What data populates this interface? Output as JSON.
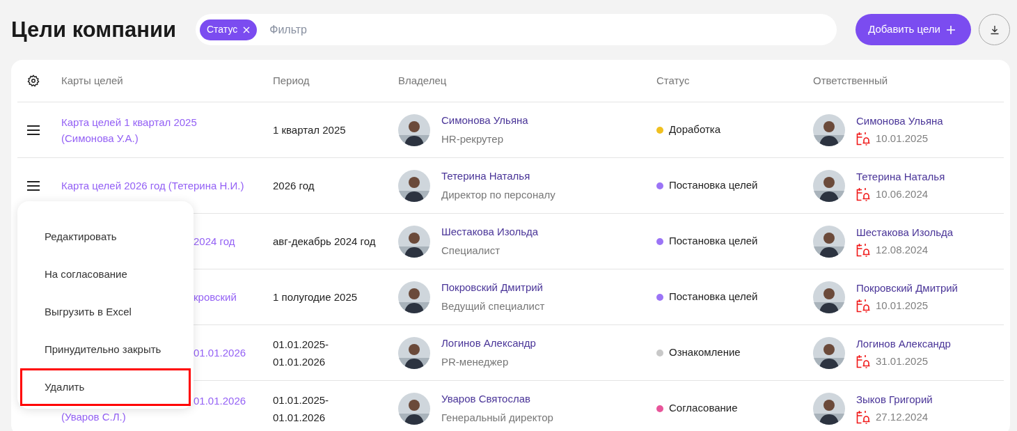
{
  "page": {
    "title": "Цели компании"
  },
  "filter": {
    "chips": [
      {
        "label": "Статус"
      }
    ],
    "placeholder": "Фильтр"
  },
  "actions": {
    "add_button": "Добавить цели"
  },
  "table": {
    "columns": [
      "Карты целей",
      "Период",
      "Владелец",
      "Статус",
      "Ответственный"
    ],
    "rows": [
      {
        "menu_icon": true,
        "goal_lines": [
          {
            "text": "Карта целей 1 квартал 2025",
            "covered": false
          },
          {
            "text": "(Симонова У.А.)",
            "covered": false
          }
        ],
        "period_lines": [
          "1 квартал 2025"
        ],
        "owner": {
          "name": "Симонова Ульяна",
          "role": "HR-рекрутер"
        },
        "status": {
          "label": "Доработка",
          "color": "#f0c020"
        },
        "responsible": {
          "name": "Симонова Ульяна",
          "date": "10.01.2025"
        }
      },
      {
        "menu_icon": true,
        "goal_lines": [
          {
            "text": "Карта целей 2026 год (Тетерина Н.И.)",
            "covered": false
          }
        ],
        "period_lines": [
          "2026 год"
        ],
        "owner": {
          "name": "Тетерина Наталья",
          "role": "Директор по персоналу"
        },
        "status": {
          "label": "Постановка целей",
          "color": "#9b74f6"
        },
        "responsible": {
          "name": "Тетерина Наталья",
          "date": "10.06.2024"
        }
      },
      {
        "menu_icon": false,
        "goal_lines": [
          {
            "text": "2024 год",
            "covered": true
          }
        ],
        "period_lines": [
          "авг-декабрь 2024 год"
        ],
        "owner": {
          "name": "Шестакова Изольда",
          "role": "Специалист"
        },
        "status": {
          "label": "Постановка целей",
          "color": "#9b74f6"
        },
        "responsible": {
          "name": "Шестакова Изольда",
          "date": "12.08.2024"
        }
      },
      {
        "menu_icon": false,
        "goal_lines": [
          {
            "text": "кровский",
            "covered": true
          }
        ],
        "period_lines": [
          "1 полугодие 2025"
        ],
        "owner": {
          "name": "Покровский Дмитрий",
          "role": "Ведущий специалист"
        },
        "status": {
          "label": "Постановка целей",
          "color": "#9b74f6"
        },
        "responsible": {
          "name": "Покровский Дмитрий",
          "date": "10.01.2025"
        }
      },
      {
        "menu_icon": false,
        "goal_lines": [
          {
            "text": "01.01.2026",
            "covered": true
          }
        ],
        "period_lines": [
          "01.01.2025-",
          "01.01.2026"
        ],
        "owner": {
          "name": "Логинов Александр",
          "role": "PR-менеджер"
        },
        "status": {
          "label": "Ознакомление",
          "color": "#c8c8c8"
        },
        "responsible": {
          "name": "Логинов Александр",
          "date": "31.01.2025"
        }
      },
      {
        "menu_icon": false,
        "goal_lines": [
          {
            "text": "01.01.2026",
            "covered": true
          },
          {
            "text": "(Уваров С.Л.)",
            "covered": false
          }
        ],
        "period_lines": [
          "01.01.2025-",
          "01.01.2026"
        ],
        "owner": {
          "name": "Уваров Святослав",
          "role": "Генеральный директор"
        },
        "status": {
          "label": "Согласование",
          "color": "#e8559a"
        },
        "responsible": {
          "name": "Зыков Григорий",
          "date": "27.12.2024"
        }
      }
    ]
  },
  "context_menu": {
    "items": [
      {
        "label": "Редактировать",
        "highlighted": false
      },
      {
        "label": "На согласование",
        "highlighted": false
      },
      {
        "label": "Выгрузить в Excel",
        "highlighted": false
      },
      {
        "label": "Принудительно закрыть",
        "highlighted": false
      },
      {
        "label": "Удалить",
        "highlighted": true
      }
    ]
  }
}
